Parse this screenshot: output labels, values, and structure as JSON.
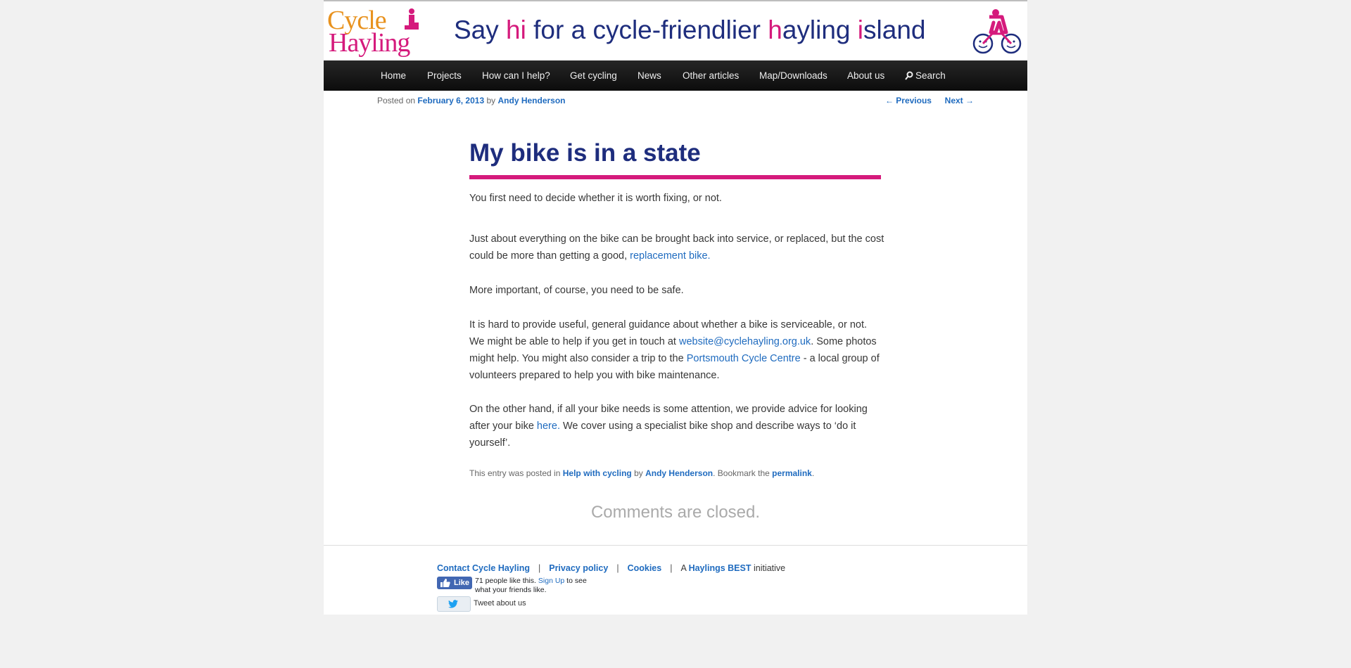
{
  "header": {
    "logo_line1": "Cycle",
    "logo_line2": "Hayling",
    "tagline_parts": [
      "Say ",
      "hi",
      " for a cycle-friendlier ",
      "h",
      "ayling ",
      "i",
      "sland"
    ]
  },
  "nav": {
    "items": [
      "Home",
      "Projects",
      "How can I help?",
      "Get cycling",
      "News",
      "Other articles",
      "Map/Downloads",
      "About us"
    ],
    "search_label": "Search"
  },
  "post_meta": {
    "posted_on": "Posted on",
    "date": "February 6, 2013",
    "by": "by",
    "author": "Andy Henderson",
    "previous": "← Previous",
    "next": "Next →"
  },
  "article": {
    "title": "My bike is in a state",
    "p1": "You first need to decide whether it is worth fixing, or not.",
    "p2_text": "Just about everything on the bike can be brought back into service, or replaced, but the cost could be more than getting a good, ",
    "p2_link": "replacement bike.",
    "p3": "More important, of course, you need to be safe.",
    "p4_text1": "It is hard to provide useful, general guidance about whether a bike is serviceable, or not.  We might be able to help if you get in touch at ",
    "p4_email": "website@cyclehayling.org.uk",
    "p4_text2": ". Some photos might help.  You might also consider a trip to the ",
    "p4_link": "Portsmouth Cycle Centre",
    "p4_text3": " - a local group of volunteers prepared to help you with bike maintenance.",
    "p5_text1": "On the other hand, if all your bike needs is some attention, we provide advice for looking after your bike ",
    "p5_link": "here.",
    "p5_text2": "  We cover using a specialist bike shop and describe ways to ‘do it yourself’.",
    "entry_prefix": "This entry was posted in ",
    "entry_category": "Help with cycling",
    "entry_by": " by ",
    "entry_author": "Andy Henderson",
    "entry_bookmark": ". Bookmark the ",
    "entry_permalink": "permalink",
    "entry_end": "."
  },
  "comments_closed": "Comments are closed.",
  "footer": {
    "contact": "Contact Cycle Hayling",
    "privacy": "Privacy policy",
    "cookies": "Cookies",
    "initiative_prefix": "A ",
    "initiative_link": "Haylings BEST",
    "initiative_suffix": " initiative",
    "separator": "|",
    "fb_like": "Like",
    "fb_count_text": "71 people like this. ",
    "fb_signup": "Sign Up",
    "fb_suffix": " to see what your friends like.",
    "tweet_text": "Tweet about us"
  },
  "colors": {
    "brand_blue": "#1e2d7d",
    "brand_pink": "#d51a7c",
    "brand_orange": "#e8921e",
    "link_blue": "#1f6bbf"
  }
}
